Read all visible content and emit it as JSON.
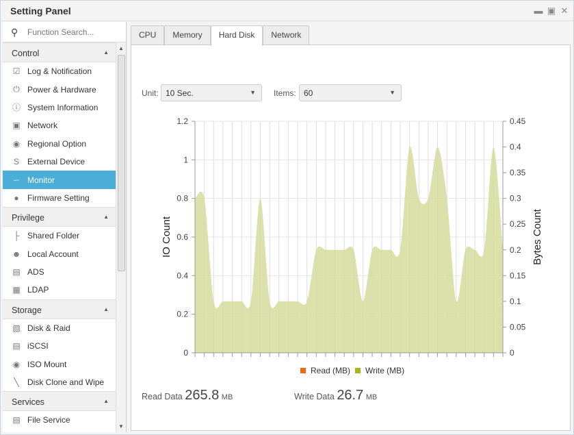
{
  "window": {
    "title": "Setting Panel",
    "controls": [
      "minimize",
      "maximize",
      "close"
    ]
  },
  "sidebar": {
    "search_placeholder": "Function Search...",
    "sections": [
      {
        "label": "Control",
        "items": [
          {
            "label": "Log & Notification",
            "icon": "clipboard-check-icon"
          },
          {
            "label": "Power & Hardware",
            "icon": "power-icon"
          },
          {
            "label": "System Information",
            "icon": "info-icon"
          },
          {
            "label": "Network",
            "icon": "ethernet-icon"
          },
          {
            "label": "Regional Option",
            "icon": "globe-icon"
          },
          {
            "label": "External Device",
            "icon": "cable-icon"
          },
          {
            "label": "Monitor",
            "icon": "line-chart-icon",
            "active": true
          },
          {
            "label": "Firmware Setting",
            "icon": "fw-icon"
          }
        ]
      },
      {
        "label": "Privilege",
        "items": [
          {
            "label": "Shared Folder",
            "icon": "folder-tree-icon"
          },
          {
            "label": "Local Account",
            "icon": "users-icon"
          },
          {
            "label": "ADS",
            "icon": "id-card-icon"
          },
          {
            "label": "LDAP",
            "icon": "directory-icon"
          }
        ]
      },
      {
        "label": "Storage",
        "items": [
          {
            "label": "Disk & Raid",
            "icon": "disk-raid-icon"
          },
          {
            "label": "iSCSI",
            "icon": "iscsi-icon"
          },
          {
            "label": "ISO Mount",
            "icon": "disc-icon"
          },
          {
            "label": "Disk Clone and Wipe",
            "icon": "broom-icon"
          }
        ]
      },
      {
        "label": "Services",
        "items": [
          {
            "label": "File Service",
            "icon": "file-server-icon"
          }
        ]
      }
    ]
  },
  "tabs": [
    {
      "label": "CPU"
    },
    {
      "label": "Memory"
    },
    {
      "label": "Hard Disk",
      "active": true
    },
    {
      "label": "Network"
    }
  ],
  "controls": {
    "unit_label": "Unit:",
    "unit_value": "10 Sec.",
    "items_label": "Items:",
    "items_value": "60"
  },
  "stats": {
    "read_label": "Read Data",
    "read_value": "265.8",
    "read_unit": "MB",
    "write_label": "Write Data",
    "write_value": "26.7",
    "write_unit": "MB"
  },
  "chart_data": {
    "type": "area",
    "ylabel": "IO Count",
    "y2label": "Bytes Count",
    "ylim": [
      0,
      1.2
    ],
    "yticks": [
      "0",
      "0.2",
      "0.4",
      "0.6",
      "0.8",
      "1",
      "1.2"
    ],
    "y2lim": [
      0,
      0.45
    ],
    "y2ticks": [
      "0",
      "0.05",
      "0.1",
      "0.15",
      "0.2",
      "0.25",
      "0.3",
      "0.35",
      "0.4",
      "0.45"
    ],
    "grid": true,
    "legend": "bottom",
    "series": [
      {
        "name": "Read (MB)",
        "color": "#f26a10",
        "axis": "right",
        "values": [
          0,
          0,
          0,
          0,
          0,
          0,
          0,
          0,
          0,
          0,
          0,
          0,
          0,
          0,
          0,
          0,
          0,
          0,
          0,
          0,
          0,
          0,
          0,
          0,
          0,
          0,
          0,
          0,
          0,
          0,
          0,
          0,
          0,
          0
        ]
      },
      {
        "name": "Write (MB)",
        "color": "#a7b51b",
        "fill": "#d6dc9c",
        "axis": "right",
        "values": [
          0.3,
          0.3,
          0.1,
          0.1,
          0.1,
          0.1,
          0.1,
          0.3,
          0.1,
          0.1,
          0.1,
          0.1,
          0.1,
          0.2,
          0.2,
          0.2,
          0.2,
          0.2,
          0.1,
          0.2,
          0.2,
          0.2,
          0.2,
          0.4,
          0.3,
          0.3,
          0.4,
          0.3,
          0.1,
          0.2,
          0.2,
          0.2,
          0.4,
          0.2
        ]
      }
    ]
  }
}
